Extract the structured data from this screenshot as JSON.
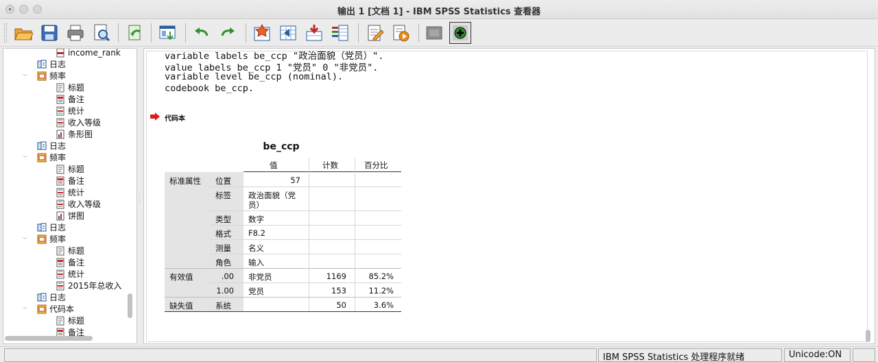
{
  "window": {
    "title": "输出 1 [文档 1] - IBM SPSS Statistics 查看器"
  },
  "toolbar": {
    "buttons": [
      "open-icon",
      "save-icon",
      "print-icon",
      "print-preview-icon",
      "export-icon",
      "recall-dialog-icon",
      "undo-icon",
      "redo-icon",
      "goto-data-icon",
      "goto-case-icon",
      "goto-variable-icon",
      "variables-icon",
      "select-last-output-icon",
      "designate-window-icon",
      "hide-icon",
      "insert-icon"
    ]
  },
  "tree": {
    "items": [
      {
        "label": "income_rank",
        "icon": "variable-icon"
      },
      {
        "label": "日志",
        "icon": "log-icon"
      },
      {
        "label": "频率",
        "icon": "procedure-icon"
      },
      {
        "label": "标题",
        "icon": "title-icon"
      },
      {
        "label": "备注",
        "icon": "notes-icon"
      },
      {
        "label": "统计",
        "icon": "table-icon"
      },
      {
        "label": "收入等级",
        "icon": "table-icon"
      },
      {
        "label": "条形图",
        "icon": "chart-icon"
      },
      {
        "label": "日志",
        "icon": "log-icon"
      },
      {
        "label": "频率",
        "icon": "procedure-icon"
      },
      {
        "label": "标题",
        "icon": "title-icon"
      },
      {
        "label": "备注",
        "icon": "notes-icon"
      },
      {
        "label": "统计",
        "icon": "table-icon"
      },
      {
        "label": "收入等级",
        "icon": "table-icon"
      },
      {
        "label": "饼图",
        "icon": "chart-icon"
      },
      {
        "label": "日志",
        "icon": "log-icon"
      },
      {
        "label": "频率",
        "icon": "procedure-icon"
      },
      {
        "label": "标题",
        "icon": "title-icon"
      },
      {
        "label": "备注",
        "icon": "notes-icon"
      },
      {
        "label": "统计",
        "icon": "table-icon"
      },
      {
        "label": "2015年总收入",
        "icon": "table-icon"
      },
      {
        "label": "日志",
        "icon": "log-icon"
      },
      {
        "label": "代码本",
        "icon": "procedure-icon"
      },
      {
        "label": "标题",
        "icon": "title-icon"
      },
      {
        "label": "备注",
        "icon": "notes-icon"
      }
    ]
  },
  "syntax": {
    "lines": [
      "variable labels be_ccp \"政治面貌（党员）\".",
      "value labels be_ccp 1 \"党员\" 0 \"非党员\".",
      "variable level be_ccp (nominal).",
      "codebook be_ccp."
    ]
  },
  "output": {
    "section_label": "代码本",
    "table": {
      "title": "be_ccp",
      "headers": [
        "值",
        "计数",
        "百分比"
      ],
      "group_labels": [
        "标准属性",
        "有效值",
        "缺失值"
      ],
      "rows": [
        {
          "sub": "位置",
          "value": "57",
          "count": "",
          "pct": ""
        },
        {
          "sub": "标签",
          "value": "政治面貌（党",
          "value2": "员）",
          "count": "",
          "pct": ""
        },
        {
          "sub": "类型",
          "value": "数字",
          "count": "",
          "pct": ""
        },
        {
          "sub": "格式",
          "value": "F8.2",
          "count": "",
          "pct": ""
        },
        {
          "sub": "测量",
          "value": "名义",
          "count": "",
          "pct": ""
        },
        {
          "sub": "角色",
          "value": "输入",
          "count": "",
          "pct": ""
        },
        {
          "sub": ".00",
          "value": "非党员",
          "count": "1169",
          "pct": "85.2%"
        },
        {
          "sub": "1.00",
          "value": "党员",
          "count": "153",
          "pct": "11.2%"
        },
        {
          "sub": "系统",
          "value": "",
          "count": "50",
          "pct": "3.6%"
        }
      ]
    }
  },
  "status": {
    "message": "IBM SPSS Statistics 处理程序就绪",
    "encoding": "Unicode:ON"
  }
}
